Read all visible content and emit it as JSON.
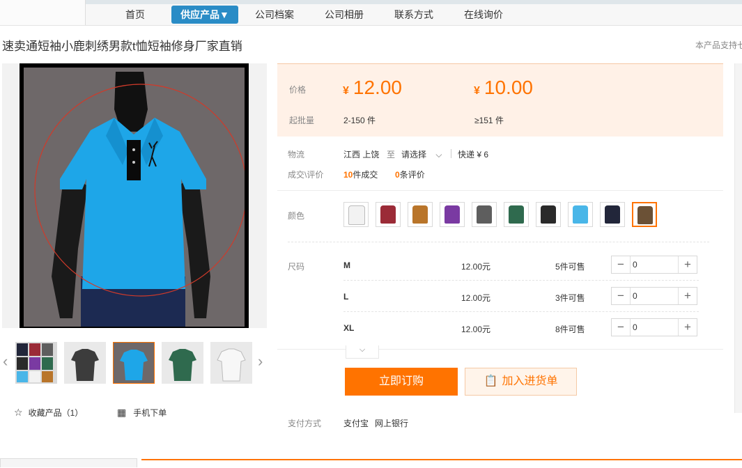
{
  "nav": {
    "items": [
      {
        "label": "首页",
        "active": false
      },
      {
        "label": "供应产品▼",
        "active": true
      },
      {
        "label": "公司档案",
        "active": false
      },
      {
        "label": "公司相册",
        "active": false
      },
      {
        "label": "联系方式",
        "active": false
      },
      {
        "label": "在线询价",
        "active": false
      }
    ]
  },
  "product": {
    "title": "速卖通短袖小鹿刺绣男款t恤短袖修身厂家直销",
    "support_note": "本产品支持七"
  },
  "gallery": {
    "thumbnails": [
      "multi-color",
      "dark-grey",
      "sky-blue",
      "green",
      "white"
    ],
    "selected_index": 2,
    "prev_icon": "‹",
    "next_icon": "›"
  },
  "actions_left": {
    "favorite_label": "收藏产品（1）",
    "mobile_label": "手机下单"
  },
  "pricing": {
    "price_label": "价格",
    "min_label": "起批量",
    "currency": "¥",
    "tiers": [
      {
        "price": "12.00",
        "quantity": "2-150 件"
      },
      {
        "price": "10.00",
        "quantity": "≥151 件"
      }
    ]
  },
  "logistics": {
    "label": "物流",
    "from": "江西 上饶",
    "to_word": "至",
    "destination_placeholder": "请选择",
    "express": "快递 ¥ 6"
  },
  "deals": {
    "label": "成交\\评价",
    "sold_count": "10",
    "sold_text": "件成交",
    "review_count": "0",
    "review_text": "条评价"
  },
  "colors": {
    "label": "颜色",
    "swatches": [
      "#f2f2f2",
      "#9b2b37",
      "#b9752a",
      "#7a3aa2",
      "#5e5e5e",
      "#2f6a4e",
      "#2a2a2a",
      "#49b6e8",
      "#22263a",
      "#6b5136"
    ],
    "selected_index": 9
  },
  "sizes": {
    "label": "尺码",
    "rows": [
      {
        "name": "M",
        "price": "12.00元",
        "stock": "5件可售",
        "qty": "0"
      },
      {
        "name": "L",
        "price": "12.00元",
        "stock": "3件可售",
        "qty": "0"
      },
      {
        "name": "XL",
        "price": "12.00元",
        "stock": "8件可售",
        "qty": "0"
      }
    ]
  },
  "buttons": {
    "buy_now": "立即订购",
    "add_to_list": "加入进货单"
  },
  "payment": {
    "label": "支付方式",
    "methods": [
      "支付宝",
      "网上银行"
    ]
  },
  "theme": {
    "accent": "#ff7300",
    "nav_active": "#2a8cc6",
    "price_bg": "#fff1e7"
  }
}
